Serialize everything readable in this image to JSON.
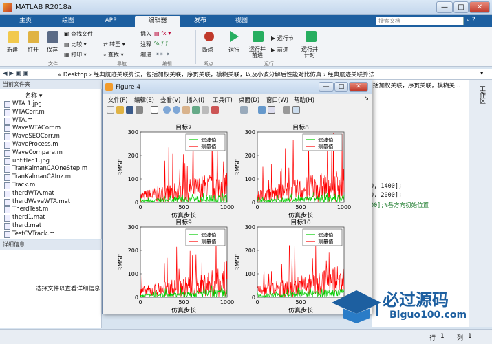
{
  "window": {
    "title": "MATLAB R2018a",
    "min": "—",
    "max": "□",
    "close": "✕"
  },
  "tabs": [
    "主页",
    "绘图",
    "APP",
    "编辑器",
    "发布",
    "视图"
  ],
  "active_tab": 3,
  "search": {
    "placeholder": "搜索文档"
  },
  "ribbon": {
    "new": "新建",
    "open": "打开",
    "save": "保存",
    "find_files": "查找文件",
    "compare": "比较",
    "print": "打印",
    "insert": "插入",
    "comment": "注释",
    "indent": "缩进",
    "goto": "转至",
    "find": "查找",
    "breakpoint": "断点",
    "run": "运行",
    "run_advance": "运行并\n前进",
    "run_section": "运行节",
    "advance": "前进",
    "run_time": "运行并\n计时",
    "groups": {
      "file": "文件",
      "nav": "导航",
      "edit": "编辑",
      "bp": "断点",
      "run": "运行"
    }
  },
  "address": {
    "path": "« Desktop › 经典航迹关联算法，包括加权关联，序贯关联，模糊关联，以及小波分解后性能对比仿真 › 经典航迹关联算法"
  },
  "current_folder": {
    "header": "当前文件夹",
    "col": "名称 ▾",
    "files": [
      "WTA 1.jpg",
      "WTACorr.m",
      "WTA.m",
      "WaveWTACorr.m",
      "WaveSEQCorr.m",
      "WaveProcess.m",
      "WaveCompare.m",
      "untitled1.jpg",
      "TranKalmanCAOneStep.m",
      "TranKalmanCAInz.m",
      "Track.m",
      "therdWTA.mat",
      "therdWaveWTA.mat",
      "TherdTest.m",
      "therd1.mat",
      "therd.mat",
      "TestCVTrack.m"
    ]
  },
  "details": {
    "header": "详细信息",
    "hint": "选择文件以查看详细信息"
  },
  "editor": {
    "breadcrumb_tail": "括加权关联，序贯关联，模糊关...",
    "lines": [
      "0, 1400];",
      "0, 2000];",
      "00];%各方向初始位置"
    ]
  },
  "right_panel": {
    "label": "工作区"
  },
  "status": {
    "row_label": "行",
    "row": "1",
    "col_label": "列",
    "col": "1"
  },
  "figure": {
    "title": "Figure 4",
    "menu": [
      "文件(F)",
      "编辑(E)",
      "查看(V)",
      "插入(I)",
      "工具(T)",
      "桌面(D)",
      "窗口(W)",
      "帮助(H)"
    ]
  },
  "chart_data": [
    {
      "type": "line",
      "title": "目标7",
      "xlabel": "仿真步长",
      "ylabel": "RMSE",
      "xlim": [
        0,
        1000
      ],
      "ylim": [
        0,
        300
      ],
      "xticks": [
        0,
        500,
        1000
      ],
      "yticks": [
        0,
        100,
        200,
        300
      ],
      "legend": [
        "滤波值",
        "测量值"
      ],
      "legend_position": "top-right",
      "series": [
        {
          "name": "滤波值",
          "color": "#00cc00",
          "typical": 15,
          "peak": 40
        },
        {
          "name": "测量值",
          "color": "#ff0000",
          "typical": 60,
          "peak": 290
        }
      ]
    },
    {
      "type": "line",
      "title": "目标8",
      "xlabel": "仿真步长",
      "ylabel": "RMSE",
      "xlim": [
        0,
        1000
      ],
      "ylim": [
        0,
        300
      ],
      "xticks": [
        0,
        500,
        1000
      ],
      "yticks": [
        0,
        100,
        200,
        300
      ],
      "legend": [
        "滤波值",
        "测量值"
      ],
      "legend_position": "top-right",
      "series": [
        {
          "name": "滤波值",
          "color": "#00cc00",
          "typical": 15,
          "peak": 45
        },
        {
          "name": "测量值",
          "color": "#ff0000",
          "typical": 65,
          "peak": 295
        }
      ]
    },
    {
      "type": "line",
      "title": "目标9",
      "xlabel": "仿真步长",
      "ylabel": "RMSE",
      "xlim": [
        0,
        1000
      ],
      "ylim": [
        0,
        300
      ],
      "xticks": [
        0,
        500,
        1000
      ],
      "yticks": [
        0,
        100,
        200,
        300
      ],
      "legend": [
        "滤波值",
        "测量值"
      ],
      "legend_position": "top-right",
      "series": [
        {
          "name": "滤波值",
          "color": "#00cc00",
          "typical": 15,
          "peak": 50
        },
        {
          "name": "测量值",
          "color": "#ff0000",
          "typical": 55,
          "peak": 250
        }
      ]
    },
    {
      "type": "line",
      "title": "目标10",
      "xlabel": "仿真步长",
      "ylabel": "RMSE",
      "xlim": [
        0,
        1000
      ],
      "ylim": [
        0,
        300
      ],
      "xticks": [
        0,
        500,
        1000
      ],
      "yticks": [
        0,
        100,
        200,
        300
      ],
      "legend": [
        "滤波值",
        "测量值"
      ],
      "legend_position": "top-right",
      "series": [
        {
          "name": "滤波值",
          "color": "#00cc00",
          "typical": 15,
          "peak": 45
        },
        {
          "name": "测量值",
          "color": "#ff0000",
          "typical": 60,
          "peak": 260
        }
      ]
    }
  ],
  "watermark": {
    "title": "必过源码",
    "url": "Biguo100.com"
  }
}
